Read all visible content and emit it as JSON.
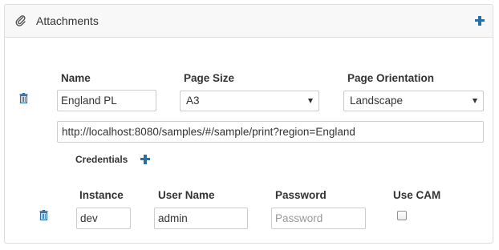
{
  "panel": {
    "title": "Attachments",
    "add_icon": "plus-icon",
    "title_icon": "paperclip-icon"
  },
  "attachment": {
    "labels": {
      "name": "Name",
      "page_size": "Page Size",
      "page_orientation": "Page Orientation"
    },
    "name_value": "England PL",
    "page_size_value": "A3",
    "page_orientation_value": "Landscape",
    "url_value": "http://localhost:8080/samples/#/sample/print?region=England",
    "delete_icon": "trash-icon"
  },
  "credentials": {
    "title": "Credentials",
    "add_icon": "plus-icon",
    "labels": {
      "instance": "Instance",
      "user_name": "User Name",
      "password": "Password",
      "use_cam": "Use CAM"
    },
    "row": {
      "instance_value": "dev",
      "user_name_value": "admin",
      "password_placeholder": "Password",
      "use_cam_checked": false,
      "delete_icon": "trash-icon"
    }
  },
  "colors": {
    "accent": "#2a6ea6",
    "border": "#dddddd",
    "heading_bg": "#f8f8f8"
  }
}
